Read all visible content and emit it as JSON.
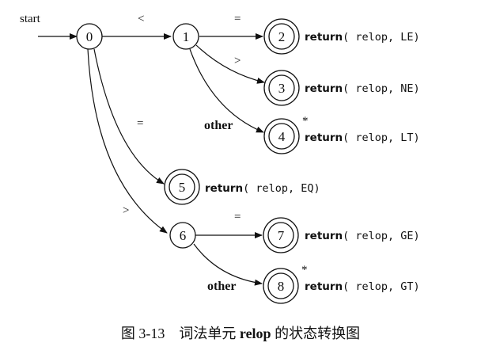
{
  "diagram": {
    "start_label": "start",
    "states": [
      "0",
      "1",
      "2",
      "3",
      "4",
      "5",
      "6",
      "7",
      "8"
    ],
    "edge_labels": {
      "e01": "<",
      "e12": "=",
      "e13": ">",
      "e14": "other",
      "e05": "=",
      "e06": ">",
      "e67": "=",
      "e68": "other"
    },
    "retract_marks": {
      "s4": "*",
      "s8": "*"
    },
    "actions": {
      "s2": {
        "keyword": "return",
        "args": "( relop, LE)"
      },
      "s3": {
        "keyword": "return",
        "args": "( relop, NE)"
      },
      "s4": {
        "keyword": "return",
        "args": "( relop, LT)"
      },
      "s5": {
        "keyword": "return",
        "args": "( relop, EQ)"
      },
      "s7": {
        "keyword": "return",
        "args": "( relop, GE)"
      },
      "s8": {
        "keyword": "return",
        "args": "( relop, GT)"
      }
    }
  },
  "caption": {
    "figure_number": "图 3-13",
    "text_before": "词法单元",
    "bold_word": "relop",
    "text_after": "的状态转换图"
  }
}
